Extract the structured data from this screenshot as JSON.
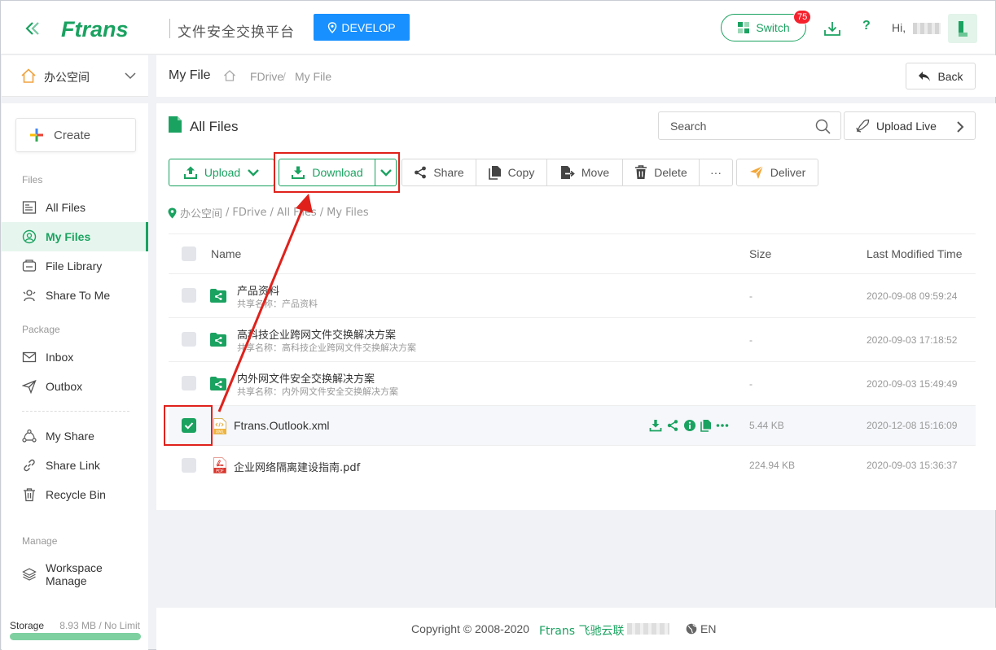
{
  "header": {
    "logo_text": "Ftrans",
    "platform_title": "文件安全交换平台",
    "env_label": "DEVELOP",
    "switch_label": "Switch",
    "switch_badge": "75",
    "help_label": "?",
    "greeting": "Hi,"
  },
  "workspace": {
    "name": "办公空间"
  },
  "sidebar": {
    "create_label": "Create",
    "sections": {
      "files": "Files",
      "package": "Package",
      "manage": "Manage"
    },
    "items": [
      {
        "label": "All Files",
        "icon": "all-files-icon"
      },
      {
        "label": "My Files",
        "icon": "my-files-icon",
        "active": true
      },
      {
        "label": "File Library",
        "icon": "file-library-icon"
      },
      {
        "label": "Share To Me",
        "icon": "share-to-me-icon"
      },
      {
        "label": "Inbox",
        "icon": "inbox-icon"
      },
      {
        "label": "Outbox",
        "icon": "outbox-icon"
      },
      {
        "label": "My Share",
        "icon": "my-share-icon"
      },
      {
        "label": "Share Link",
        "icon": "share-link-icon"
      },
      {
        "label": "Recycle Bin",
        "icon": "recycle-bin-icon"
      },
      {
        "label": "Workspace Manage",
        "icon": "workspace-manage-icon"
      }
    ],
    "storage": {
      "label": "Storage",
      "value": "8.93 MB / No Limit"
    }
  },
  "page_header": {
    "title": "My File",
    "breadcrumb": [
      "FDrive",
      "My File"
    ],
    "back_label": "Back"
  },
  "main": {
    "title": "All Files",
    "search_placeholder": "Search",
    "upload_live_label": "Upload Live",
    "toolbar": {
      "upload": "Upload",
      "download": "Download",
      "share": "Share",
      "copy": "Copy",
      "move": "Move",
      "delete": "Delete",
      "more": "···",
      "deliver": "Deliver"
    },
    "path": [
      "办公空间",
      "FDrive",
      "All Files",
      "My Files"
    ],
    "columns": {
      "name": "Name",
      "size": "Size",
      "modified": "Last Modified Time"
    },
    "rows": [
      {
        "name": "产品资料",
        "sub": "共享名称：产品资料",
        "size": "-",
        "modified": "2020-09-08 09:59:24",
        "type": "shared-folder",
        "selected": false
      },
      {
        "name": "高科技企业跨网文件交换解决方案",
        "sub": "共享名称：高科技企业跨网文件交换解决方案",
        "size": "-",
        "modified": "2020-09-03 17:18:52",
        "type": "shared-folder",
        "selected": false
      },
      {
        "name": "内外网文件安全交换解决方案",
        "sub": "共享名称：内外网文件安全交换解决方案",
        "size": "-",
        "modified": "2020-09-03 15:49:49",
        "type": "shared-folder",
        "selected": false
      },
      {
        "name": "Ftrans.Outlook.xml",
        "sub": "",
        "size": "5.44 KB",
        "modified": "2020-12-08 15:16:09",
        "type": "xml",
        "selected": true
      },
      {
        "name": "企业网络隔离建设指南.pdf",
        "sub": "",
        "size": "224.94 KB",
        "modified": "2020-09-03 15:36:37",
        "type": "pdf",
        "selected": false
      }
    ]
  },
  "footer": {
    "copyright": "Copyright © 2008-2020",
    "brand": "Ftrans 飞驰云联",
    "lang": "EN"
  },
  "colors": {
    "brand_green": "#1aa260",
    "accent_blue": "#1890ff",
    "annotation_red": "#e0211b",
    "badge_red": "#f5222d"
  }
}
